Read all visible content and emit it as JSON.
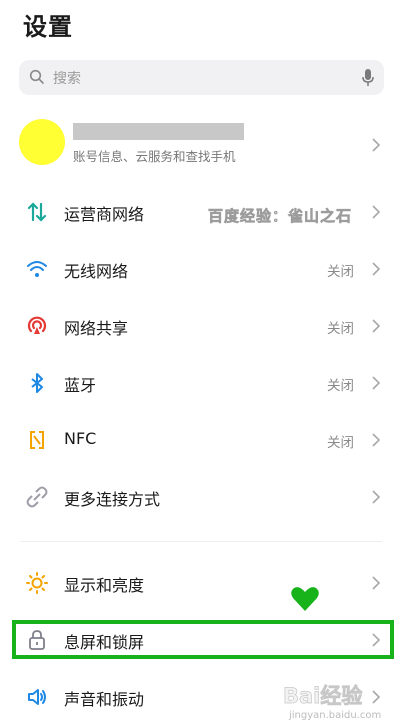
{
  "header": {
    "title": "设置"
  },
  "search": {
    "placeholder": "搜索",
    "icon": "search-icon",
    "mic_icon": "microphone-icon"
  },
  "profile": {
    "subtitle": "账号信息、云服务和查找手机",
    "avatar_color": "#ffff33"
  },
  "watermark": "百度经验：雀山之石",
  "settings": [
    {
      "label": "运营商网络",
      "status": "",
      "icon": "mobile-data-icon",
      "color": "#1aa89a"
    },
    {
      "label": "无线网络",
      "status": "关闭",
      "icon": "wifi-icon",
      "color": "#1e88e5"
    },
    {
      "label": "网络共享",
      "status": "关闭",
      "icon": "hotspot-icon",
      "color": "#e53935"
    },
    {
      "label": "蓝牙",
      "status": "关闭",
      "icon": "bluetooth-icon",
      "color": "#1e88e5"
    },
    {
      "label": "NFC",
      "status": "关闭",
      "icon": "nfc-icon",
      "color": "#f5a300"
    },
    {
      "label": "更多连接方式",
      "status": "",
      "icon": "link-icon",
      "color": "#9e9ea8"
    },
    {
      "label": "显示和亮度",
      "status": "",
      "icon": "brightness-icon",
      "color": "#f5a300"
    },
    {
      "label": "息屏和锁屏",
      "status": "",
      "icon": "lock-icon",
      "color": "#7f7f8a"
    },
    {
      "label": "声音和振动",
      "status": "",
      "icon": "speaker-icon",
      "color": "#1e88e5"
    }
  ],
  "highlight_color": "#18b21a",
  "baidu_logo": {
    "text": "Bai经验",
    "url": "jingyan.baidu.com"
  }
}
